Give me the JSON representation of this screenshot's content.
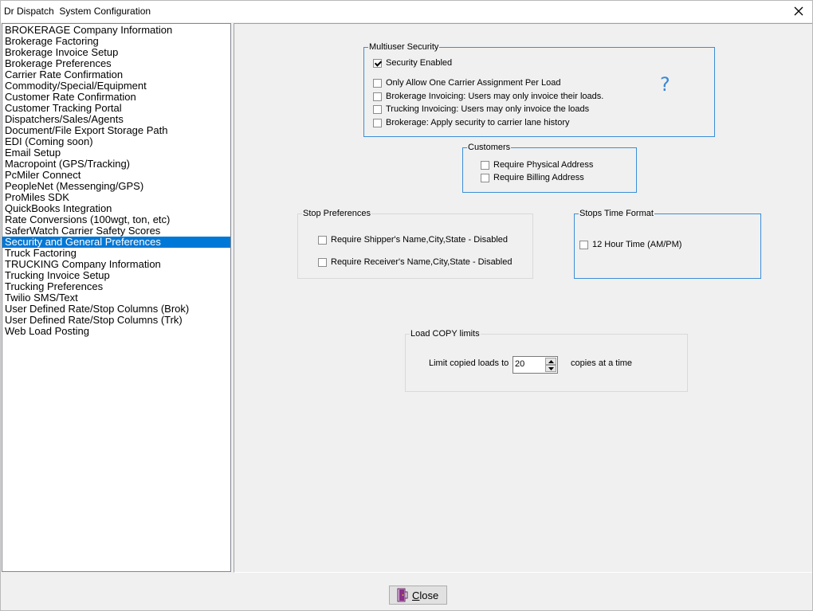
{
  "window": {
    "title": "Dr Dispatch  System Configuration"
  },
  "sidebar": {
    "items": [
      {
        "label": "BROKERAGE Company Information"
      },
      {
        "label": "Brokerage Factoring"
      },
      {
        "label": "Brokerage Invoice Setup"
      },
      {
        "label": "Brokerage Preferences"
      },
      {
        "label": "Carrier Rate Confirmation"
      },
      {
        "label": "Commodity/Special/Equipment"
      },
      {
        "label": "Customer Rate Confirmation"
      },
      {
        "label": "Customer Tracking Portal"
      },
      {
        "label": "Dispatchers/Sales/Agents"
      },
      {
        "label": "Document/File Export Storage Path"
      },
      {
        "label": "EDI (Coming soon)"
      },
      {
        "label": "Email Setup"
      },
      {
        "label": "Macropoint (GPS/Tracking)"
      },
      {
        "label": "PcMiler Connect"
      },
      {
        "label": "PeopleNet (Messenging/GPS)"
      },
      {
        "label": "ProMiles SDK"
      },
      {
        "label": "QuickBooks Integration"
      },
      {
        "label": "Rate Conversions (100wgt, ton, etc)"
      },
      {
        "label": "SaferWatch Carrier Safety Scores"
      },
      {
        "label": "Security and General Preferences"
      },
      {
        "label": "Truck Factoring"
      },
      {
        "label": "TRUCKING Company Information"
      },
      {
        "label": "Trucking Invoice Setup"
      },
      {
        "label": "Trucking Preferences"
      },
      {
        "label": "Twilio SMS/Text"
      },
      {
        "label": "User Defined Rate/Stop Columns (Brok)"
      },
      {
        "label": "User Defined Rate/Stop Columns (Trk)"
      },
      {
        "label": "Web Load Posting"
      }
    ],
    "selected_index": 19
  },
  "multiuser": {
    "title": "Multiuser Security",
    "options": [
      {
        "label": "Security Enabled",
        "checked": true
      },
      {
        "label": "Only Allow One Carrier Assignment Per Load",
        "checked": false
      },
      {
        "label": "Brokerage Invoicing: Users may only invoice their loads.",
        "checked": false
      },
      {
        "label": "Trucking Invoicing: Users may only invoice the loads",
        "checked": false
      },
      {
        "label": "Brokerage: Apply security to carrier lane history",
        "checked": false
      }
    ],
    "help_icon": "question-mark-icon",
    "help_glyph": "?"
  },
  "customers": {
    "title": "Customers",
    "options": [
      {
        "label": "Require Physical Address",
        "checked": false
      },
      {
        "label": "Require Billing Address",
        "checked": false
      }
    ]
  },
  "stop_preferences": {
    "title": "Stop Preferences",
    "options": [
      {
        "label": "Require Shipper's Name,City,State - Disabled",
        "checked": false
      },
      {
        "label": "Require Receiver's Name,City,State - Disabled",
        "checked": false
      }
    ]
  },
  "stops_time_format": {
    "title": "Stops Time Format",
    "options": [
      {
        "label": "12 Hour Time (AM/PM)",
        "checked": false
      }
    ]
  },
  "load_copy": {
    "title": "Load COPY limits",
    "prefix_label": "Limit copied loads to",
    "value": "20",
    "suffix_label": "copies at a time"
  },
  "footer": {
    "close_label_underlined": "C",
    "close_label_rest": "lose",
    "close_icon": "door-exit-icon"
  },
  "colors": {
    "selection": "#0078d7",
    "group_border_blue": "#3c8ed6",
    "help_icon": "#3a86d6",
    "window_bg": "#f0f0f0"
  }
}
